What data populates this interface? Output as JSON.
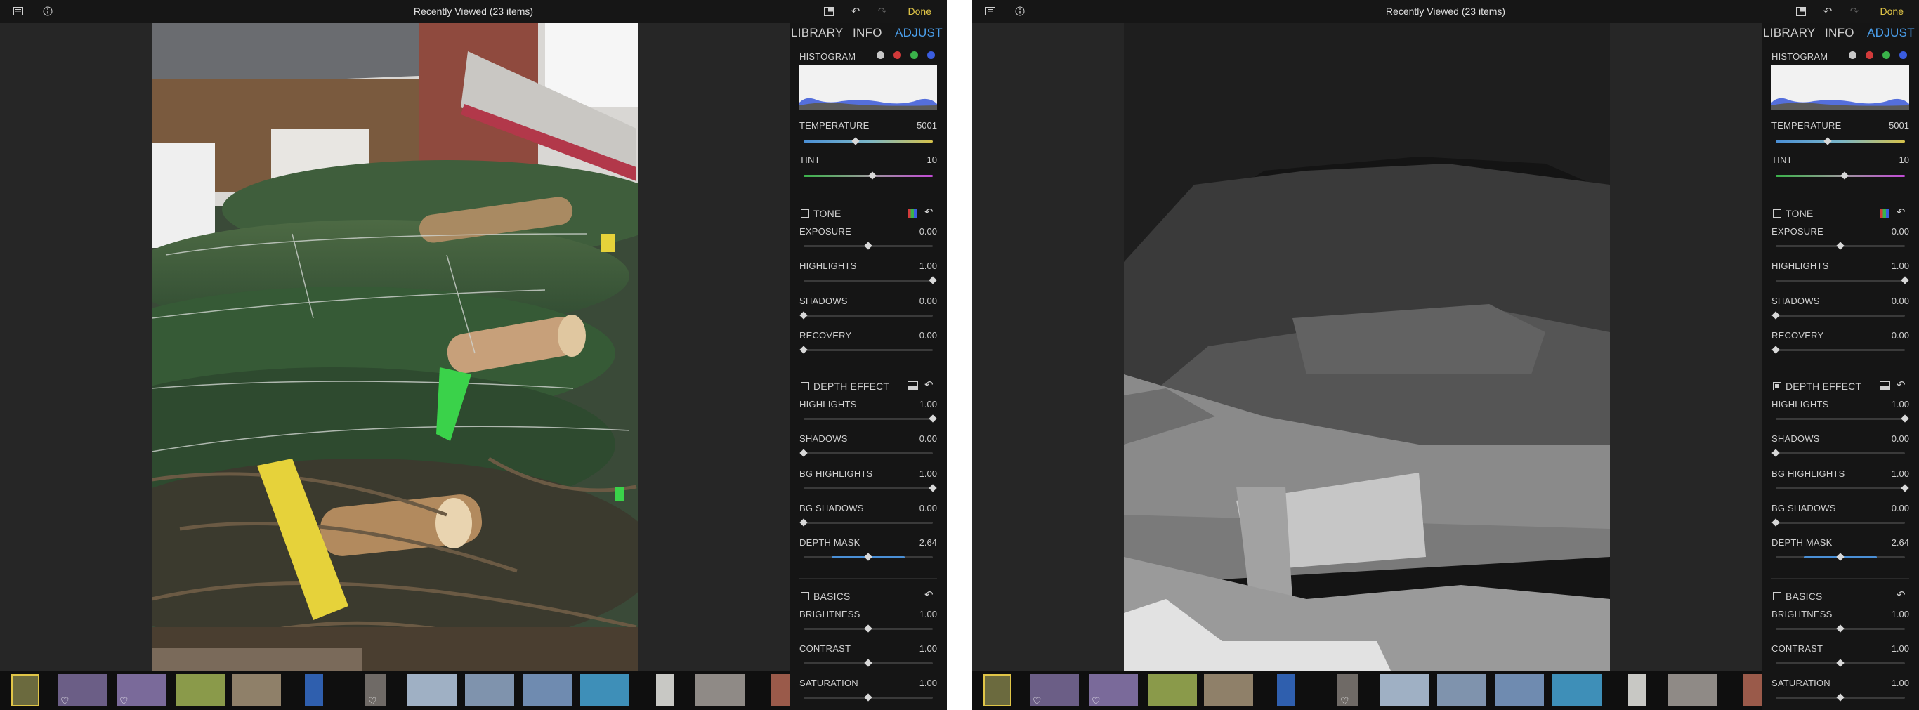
{
  "title": "Recently Viewed (23 items)",
  "done_label": "Done",
  "icons": {
    "sidebar": "sidebar-icon",
    "info": "info-icon",
    "crop": "crop-icon",
    "undo": "undo-icon",
    "redo": "redo-icon",
    "reset": "reset-arrow-icon"
  },
  "panel": {
    "tabs": [
      {
        "label": "LIBRARY"
      },
      {
        "label": "INFO"
      },
      {
        "label": "ADJUST"
      }
    ],
    "histogram_label": "HISTOGRAM",
    "channel_colors": [
      "#c8c8c8",
      "#d23a3a",
      "#3ab24a",
      "#3a5de0"
    ],
    "temperature": {
      "label": "TEMPERATURE",
      "value": "5001",
      "level": 0.4
    },
    "tint": {
      "label": "TINT",
      "value": "10",
      "level": 0.53
    },
    "tone": {
      "label": "TONE",
      "exposure": {
        "label": "EXPOSURE",
        "value": "0.00",
        "level": 0.5
      },
      "highlights": {
        "label": "HIGHLIGHTS",
        "value": "1.00",
        "level": 1.0
      },
      "shadows": {
        "label": "SHADOWS",
        "value": "0.00",
        "level": 0.0
      },
      "recovery": {
        "label": "RECOVERY",
        "value": "0.00",
        "level": 0.0
      }
    },
    "depth": {
      "label": "DEPTH EFFECT",
      "highlights": {
        "label": "HIGHLIGHTS",
        "value": "1.00",
        "level": 1.0
      },
      "shadows": {
        "label": "SHADOWS",
        "value": "0.00",
        "level": 0.0
      },
      "bg_highlights": {
        "label": "BG HIGHLIGHTS",
        "value": "1.00",
        "level": 1.0
      },
      "bg_shadows": {
        "label": "BG SHADOWS",
        "value": "0.00",
        "level": 0.0
      },
      "depth_mask": {
        "label": "DEPTH MASK",
        "value": "2.64",
        "level": 0.5
      }
    },
    "basics": {
      "label": "BASICS",
      "brightness": {
        "label": "BRIGHTNESS",
        "value": "1.00",
        "level": 0.5
      },
      "contrast": {
        "label": "CONTRAST",
        "value": "1.00",
        "level": 0.5
      },
      "saturation": {
        "label": "SATURATION",
        "value": "1.00",
        "level": 0.5
      }
    }
  },
  "screens": {
    "left": {
      "depth_checked": false
    },
    "right": {
      "depth_checked": true
    }
  },
  "filmstrip": {
    "thumbs": [
      {
        "color": "#6b6a3e",
        "favorite": false,
        "selected": true
      },
      {
        "color": "#6b5e86",
        "favorite": true,
        "selected": false
      },
      {
        "color": "#7a6a9a",
        "favorite": true,
        "selected": false
      },
      {
        "color": "#8a9a4a",
        "favorite": false,
        "selected": false
      },
      {
        "color": "#8f8069",
        "favorite": false,
        "selected": false
      },
      {
        "color": "#2f5fae",
        "favorite": false,
        "selected": false
      },
      {
        "color": "#6f6a66",
        "favorite": true,
        "selected": false
      },
      {
        "color": "#9fb0c4",
        "favorite": false,
        "selected": false
      },
      {
        "color": "#7f93ad",
        "favorite": false,
        "selected": false
      },
      {
        "color": "#6f8bb0",
        "favorite": false,
        "selected": false
      },
      {
        "color": "#3e8fb8",
        "favorite": false,
        "selected": false
      },
      {
        "color": "#c8c8c4",
        "favorite": false,
        "selected": false
      },
      {
        "color": "#8f8a86",
        "favorite": false,
        "selected": false
      },
      {
        "color": "#9a5a4a",
        "favorite": false,
        "selected": false
      }
    ]
  }
}
